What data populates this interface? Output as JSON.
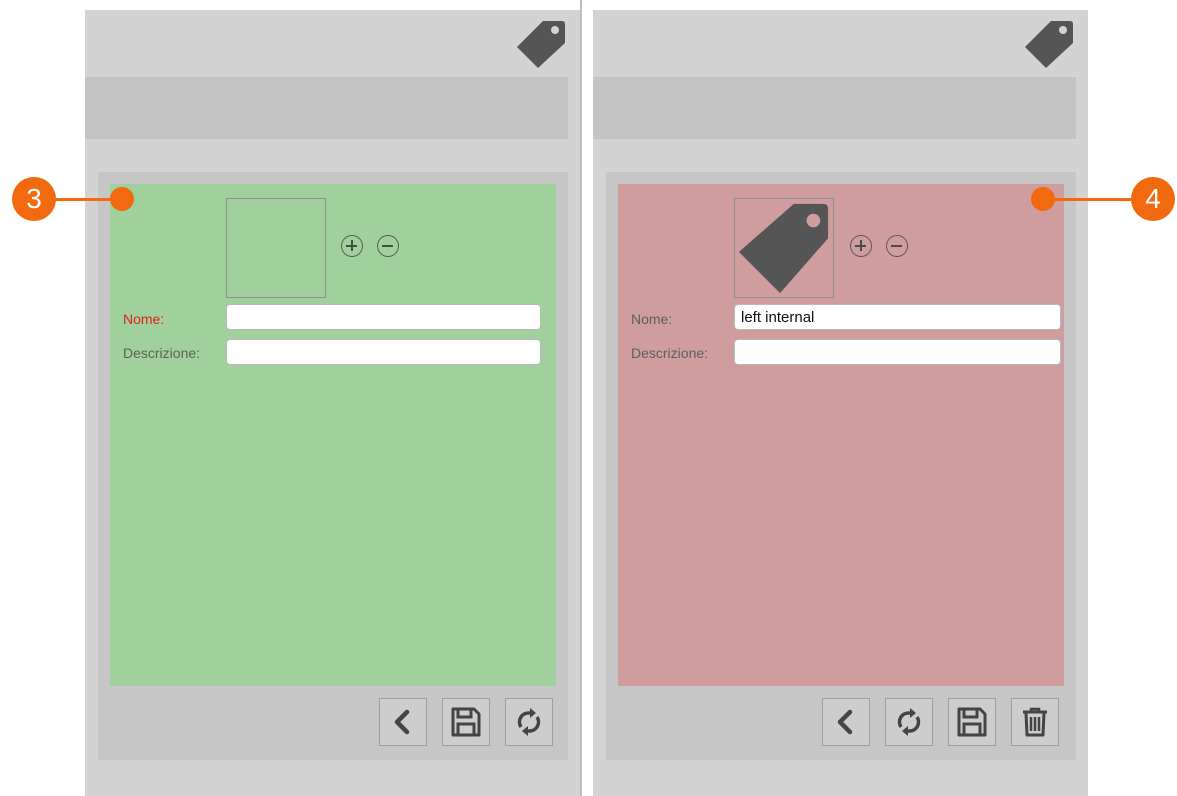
{
  "callouts": [
    {
      "number": "3"
    },
    {
      "number": "4"
    }
  ],
  "panel_left": {
    "name_label": "Nome:",
    "description_label": "Descrizione:",
    "name_value": "",
    "description_value": "",
    "status_color": "#a0d09c",
    "image": "empty",
    "actions": [
      "back-icon",
      "save-icon",
      "refresh-icon"
    ]
  },
  "panel_right": {
    "name_label": "Nome:",
    "description_label": "Descrizione:",
    "name_value": "left internal",
    "description_value": "",
    "status_color": "#cf9d9d",
    "image": "tag-icon",
    "actions": [
      "back-icon",
      "refresh-icon",
      "save-icon",
      "trash-icon"
    ]
  },
  "header_icon": "tag-icon",
  "accent_color": "#f26a0f"
}
